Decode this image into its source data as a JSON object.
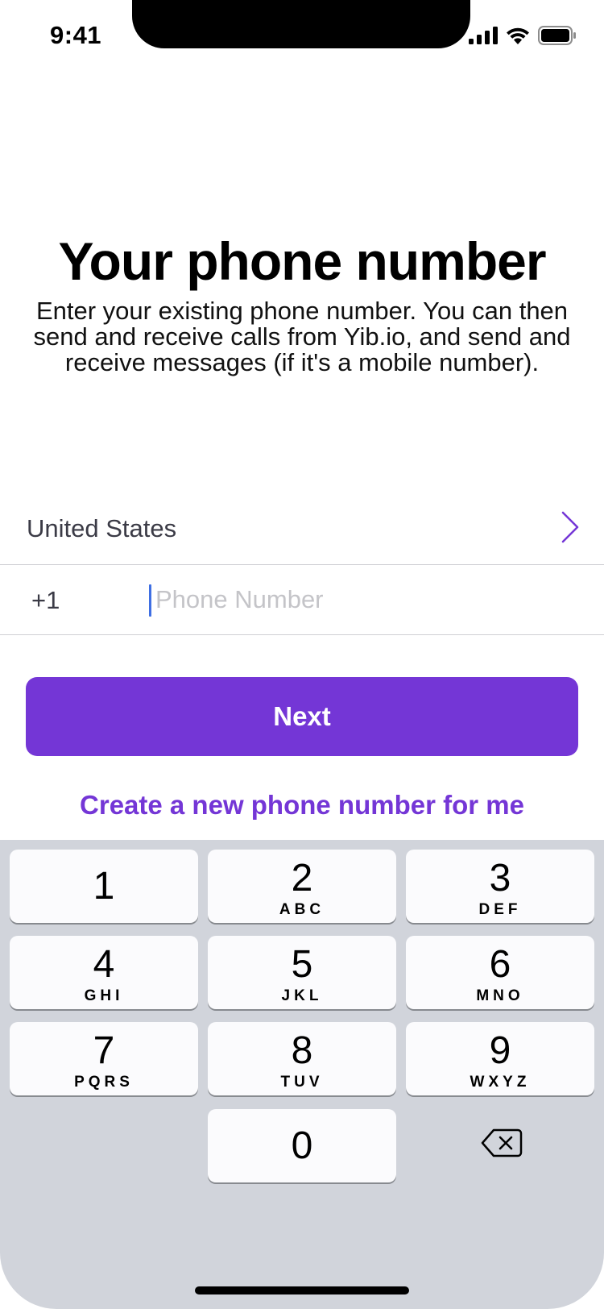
{
  "status_bar": {
    "time": "9:41"
  },
  "header": {
    "title": "Your phone number",
    "subtitle": "Enter your existing phone number. You can then send and receive calls from Yib.io, and send and receive messages (if it's a mobile number)."
  },
  "form": {
    "country": "United States",
    "dial_code": "+1",
    "phone_placeholder": "Phone Number",
    "phone_value": ""
  },
  "actions": {
    "next_label": "Next",
    "create_link_label": "Create a new phone number for me"
  },
  "keypad": {
    "keys": [
      {
        "digit": "1",
        "letters": ""
      },
      {
        "digit": "2",
        "letters": "ABC"
      },
      {
        "digit": "3",
        "letters": "DEF"
      },
      {
        "digit": "4",
        "letters": "GHI"
      },
      {
        "digit": "5",
        "letters": "JKL"
      },
      {
        "digit": "6",
        "letters": "MNO"
      },
      {
        "digit": "7",
        "letters": "PQRS"
      },
      {
        "digit": "8",
        "letters": "TUV"
      },
      {
        "digit": "9",
        "letters": "WXYZ"
      },
      {
        "digit": "0",
        "letters": ""
      }
    ],
    "backspace_icon": "backspace-icon"
  },
  "colors": {
    "accent": "#7436d6",
    "keyboard_bg": "#d1d4db",
    "cursor": "#3f6fe3"
  }
}
